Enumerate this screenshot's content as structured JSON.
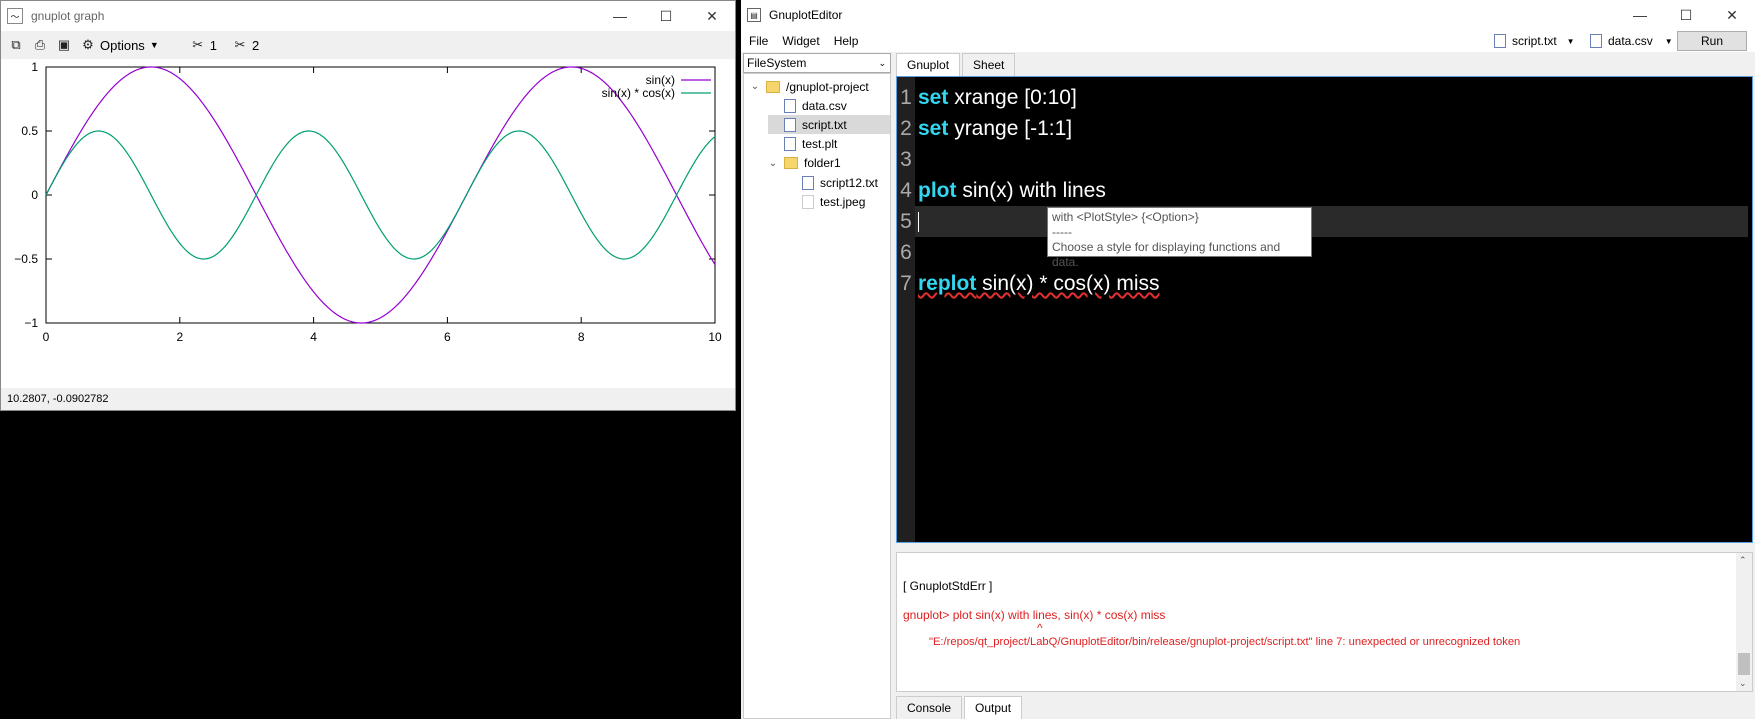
{
  "gnuplot_window": {
    "title": "gnuplot graph",
    "toolbar": {
      "options_label": "Options",
      "axis1_label": "1",
      "axis2_label": "2"
    },
    "status": "10.2807, -0.0902782"
  },
  "chart_data": {
    "type": "line",
    "xlim": [
      0,
      10
    ],
    "ylim": [
      -1,
      1
    ],
    "x_ticks": [
      "0",
      "2",
      "4",
      "6",
      "8",
      "10"
    ],
    "y_ticks": [
      "1",
      "0.5",
      "0",
      "−0.5",
      "−1"
    ],
    "legend_position": "top-right",
    "series": [
      {
        "name": "sin(x)",
        "color": "#9400d3",
        "expression": "sin(x)"
      },
      {
        "name": "sin(x) * cos(x)",
        "color": "#009e73",
        "expression": "sin(x)*cos(x)"
      }
    ]
  },
  "editor_window": {
    "title": "GnuplotEditor",
    "menu": [
      "File",
      "Widget",
      "Help"
    ],
    "file_buttons": [
      "script.txt",
      "data.csv"
    ],
    "run_label": "Run",
    "filesystem_label": "FileSystem",
    "tree": [
      {
        "label": "/gnuplot-project",
        "type": "folder",
        "level": 0,
        "expanded": true
      },
      {
        "label": "data.csv",
        "type": "file",
        "level": 1
      },
      {
        "label": "script.txt",
        "type": "file",
        "level": 1,
        "selected": true
      },
      {
        "label": "test.plt",
        "type": "file",
        "level": 1
      },
      {
        "label": "folder1",
        "type": "folder",
        "level": 1,
        "expanded": true
      },
      {
        "label": "script12.txt",
        "type": "file",
        "level": 2
      },
      {
        "label": "test.jpeg",
        "type": "file",
        "level": 2
      }
    ],
    "tabs": [
      "Gnuplot",
      "Sheet"
    ],
    "code": [
      {
        "num": "1",
        "kw": "set",
        "rest": " xrange [0:10]"
      },
      {
        "num": "2",
        "kw": "set",
        "rest": " yrange [-1:1]"
      },
      {
        "num": "3",
        "kw": "",
        "rest": ""
      },
      {
        "num": "4",
        "kw": "plot",
        "rest": " sin(x) with lines"
      },
      {
        "num": "5",
        "kw": "",
        "rest": ""
      },
      {
        "num": "6",
        "kw": "",
        "rest": ""
      },
      {
        "num": "7",
        "kw": "replot",
        "rest": " sin(x) * cos(x) miss"
      }
    ],
    "tooltip": {
      "line1": "with <PlotStyle> {<Option>}",
      "line2": "-----",
      "line3": "Choose a style for displaying functions and data."
    },
    "output": {
      "header": "[ GnuplotStdErr ]",
      "command": "gnuplot> plot sin(x) with lines, sin(x) * cos(x) miss",
      "caret": "^",
      "error": "\"E:/repos/qt_project/LabQ/GnuplotEditor/bin/release/gnuplot-project/script.txt\" line 7: unexpected or unrecognized token"
    },
    "bottom_tabs": [
      "Console",
      "Output"
    ]
  }
}
